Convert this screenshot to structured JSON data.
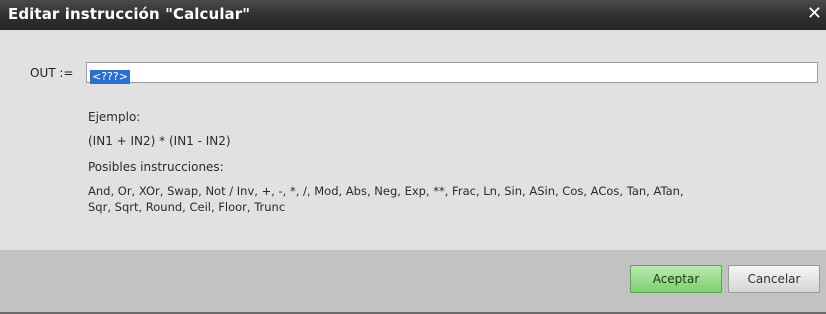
{
  "dialog": {
    "title": "Editar instrucción \"Calcular\"",
    "close_glyph": "✕"
  },
  "form": {
    "out_label": "OUT :=",
    "out_value": "<???>"
  },
  "help": {
    "example_heading": "Ejemplo:",
    "example_expression": "(IN1 + IN2) * (IN1 - IN2)",
    "instructions_heading": "Posibles instrucciones:",
    "instructions_line1": "And, Or, XOr, Swap, Not / Inv, +, -, *, /, Mod, Abs, Neg, Exp, **, Frac, Ln, Sin, ASin, Cos, ACos, Tan, ATan,",
    "instructions_line2": "Sqr, Sqrt, Round, Ceil, Floor, Trunc"
  },
  "buttons": {
    "ok_label": "Aceptar",
    "cancel_label": "Cancelar"
  },
  "colors": {
    "ok_button": "#8fd683",
    "selection": "#2d6fd0",
    "titlebar": "#333333"
  }
}
